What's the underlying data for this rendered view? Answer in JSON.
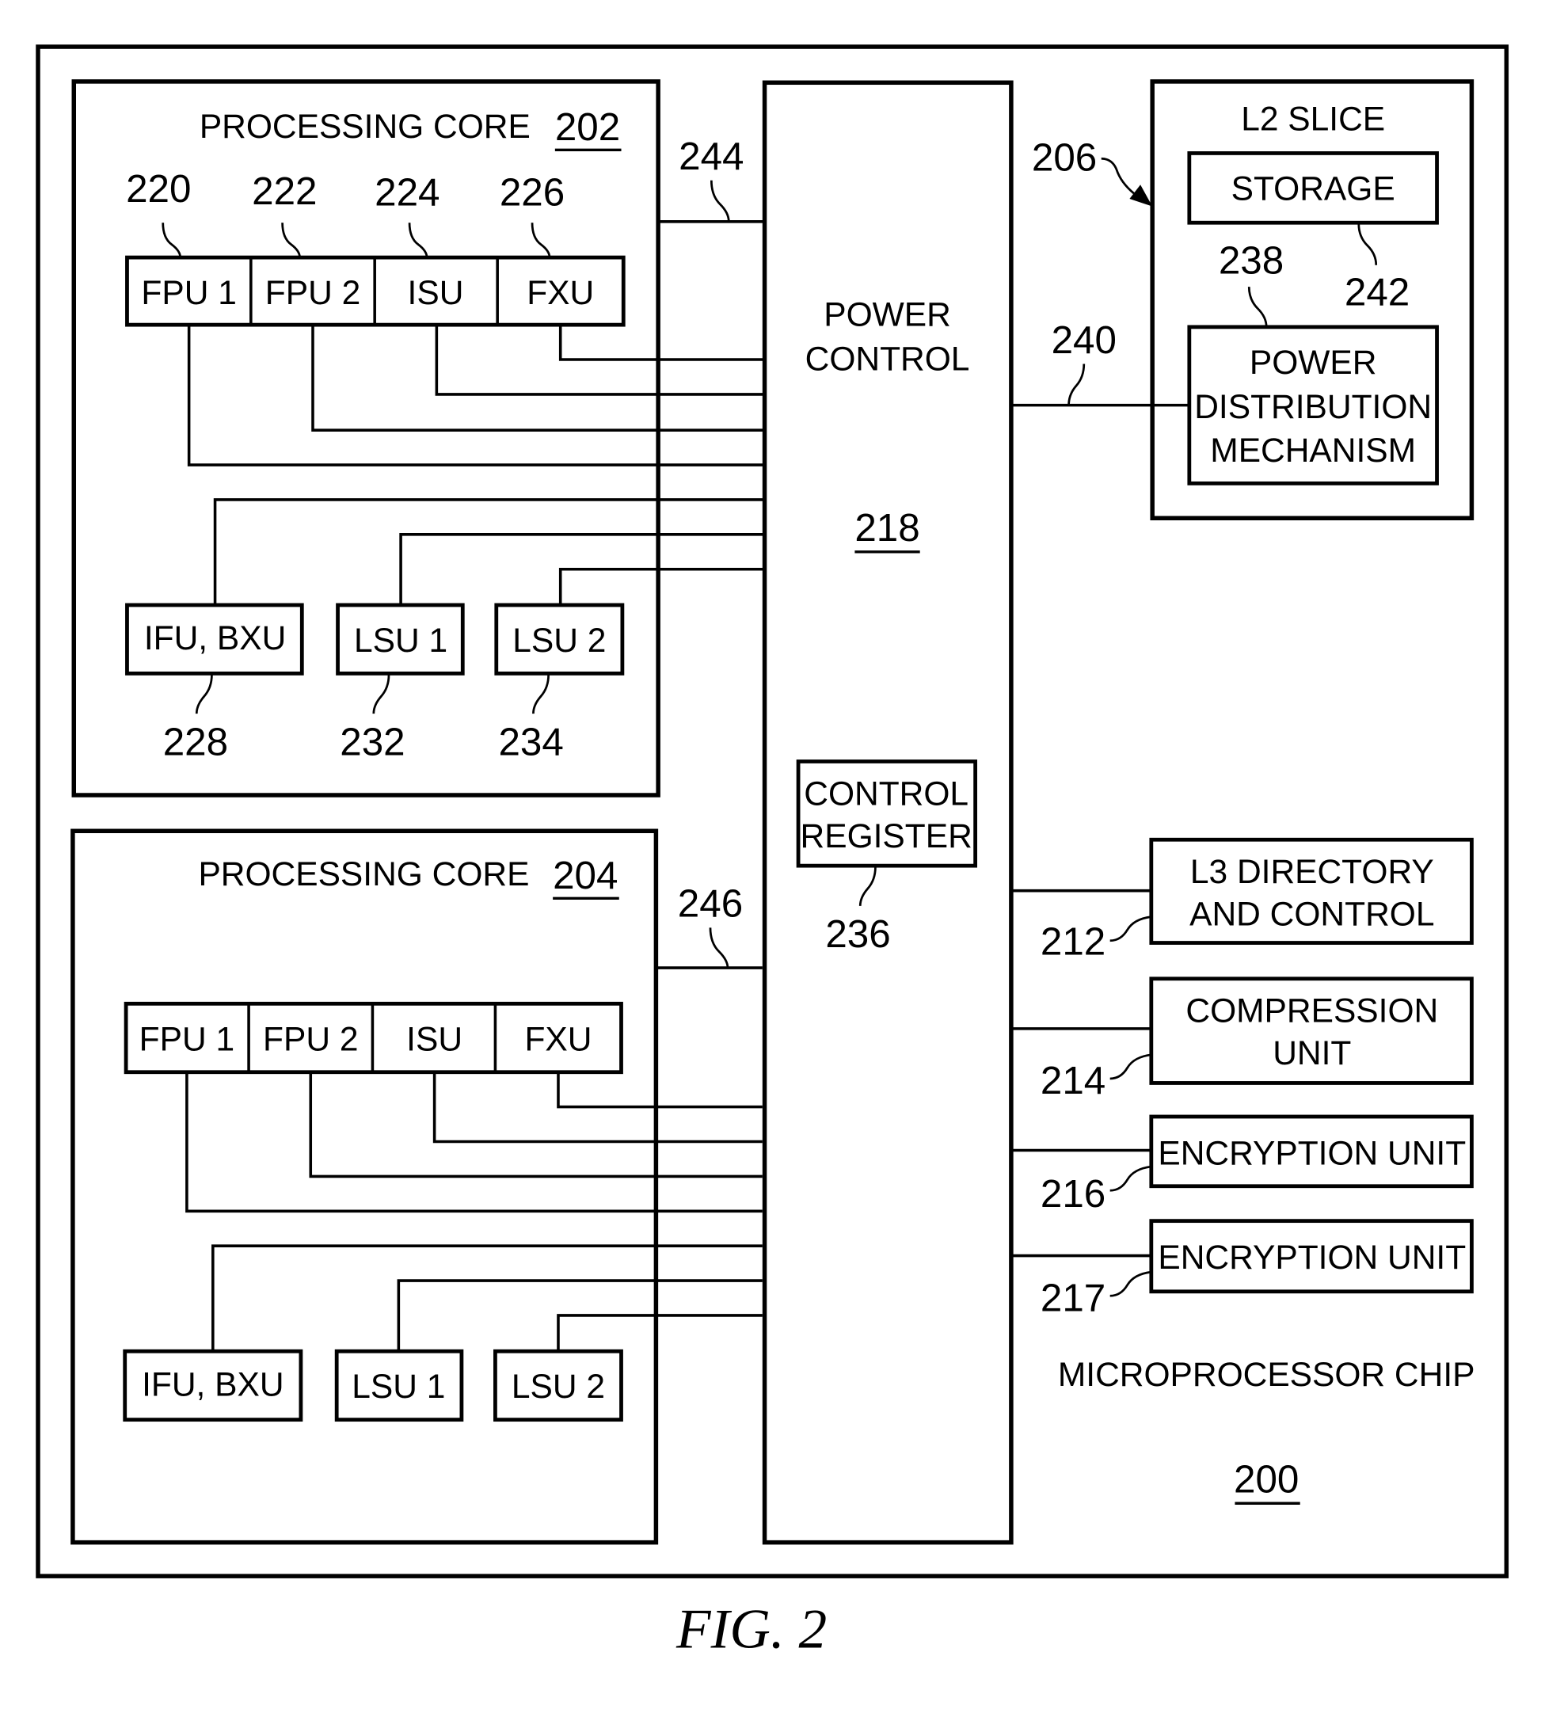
{
  "figure": {
    "caption": "FIG. 2",
    "chip": {
      "label": "MICROPROCESSOR CHIP",
      "ref": "200"
    },
    "core_top": {
      "title": "PROCESSING CORE",
      "ref": "202",
      "link_ref": "244",
      "units_row": [
        {
          "label": "FPU 1",
          "ref": "220"
        },
        {
          "label": "FPU 2",
          "ref": "222"
        },
        {
          "label": "ISU",
          "ref": "224"
        },
        {
          "label": "FXU",
          "ref": "226"
        }
      ],
      "units_bottom": [
        {
          "label": "IFU, BXU",
          "ref": "228"
        },
        {
          "label": "LSU 1",
          "ref": "232"
        },
        {
          "label": "LSU 2",
          "ref": "234"
        }
      ]
    },
    "core_bottom": {
      "title": "PROCESSING CORE",
      "ref": "204",
      "link_ref": "246",
      "units_row": [
        {
          "label": "FPU 1"
        },
        {
          "label": "FPU 2"
        },
        {
          "label": "ISU"
        },
        {
          "label": "FXU"
        }
      ],
      "units_bottom": [
        {
          "label": "IFU, BXU"
        },
        {
          "label": "LSU 1"
        },
        {
          "label": "LSU 2"
        }
      ]
    },
    "power_control": {
      "line1": "POWER",
      "line2": "CONTROL",
      "ref": "218",
      "register": {
        "line1": "CONTROL",
        "line2": "REGISTER",
        "ref": "236"
      }
    },
    "l2_slice": {
      "title": "L2 SLICE",
      "ref": "206",
      "storage": {
        "label": "STORAGE",
        "ref": "242"
      },
      "pdm": {
        "line1": "POWER",
        "line2": "DISTRIBUTION",
        "line3": "MECHANISM",
        "ref": "238"
      },
      "link_ref": "240"
    },
    "peripherals": [
      {
        "line1": "L3 DIRECTORY",
        "line2": "AND CONTROL",
        "ref": "212"
      },
      {
        "line1": "COMPRESSION",
        "line2": "UNIT",
        "ref": "214"
      },
      {
        "line1": "ENCRYPTION UNIT",
        "ref": "216"
      },
      {
        "line1": "ENCRYPTION UNIT",
        "ref": "217"
      }
    ]
  }
}
